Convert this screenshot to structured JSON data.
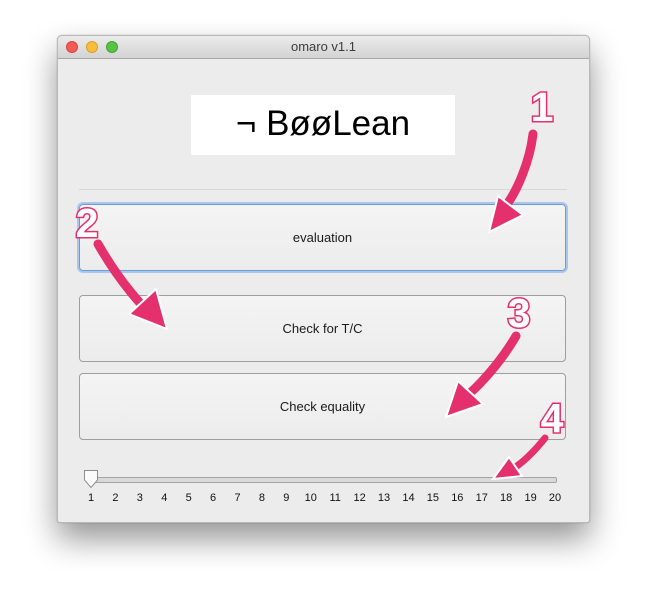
{
  "window": {
    "title": "omaro v1.1"
  },
  "logo": {
    "text": "¬ BøøLean"
  },
  "buttons": {
    "evaluation": "evaluation",
    "check_tc": "Check for T/C",
    "check_equality": "Check equality"
  },
  "slider": {
    "min": 1,
    "max": 20,
    "value": 1,
    "tick_labels": [
      "1",
      "2",
      "3",
      "4",
      "5",
      "6",
      "7",
      "8",
      "9",
      "10",
      "11",
      "12",
      "13",
      "14",
      "15",
      "16",
      "17",
      "18",
      "19",
      "20"
    ]
  },
  "annotations": {
    "markers": [
      "1",
      "2",
      "3",
      "4"
    ],
    "arrow_color": "#e4306c"
  },
  "colors": {
    "focus_ring": "#6b9cd7",
    "close": "#f25c56",
    "minimize": "#f8be3a",
    "maximize": "#59c346"
  }
}
